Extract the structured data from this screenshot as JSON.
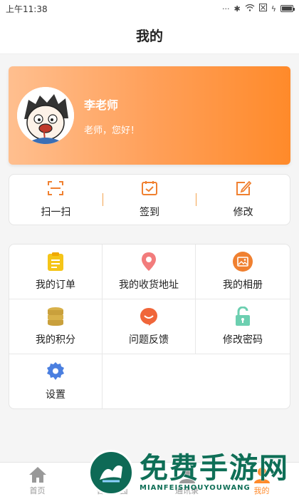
{
  "status_bar": {
    "time": "上午11:38"
  },
  "header": {
    "title": "我的"
  },
  "profile": {
    "name": "李老师",
    "greeting": "老师，您好！"
  },
  "actions": [
    {
      "label": "扫一扫",
      "icon": "scan-icon"
    },
    {
      "label": "签到",
      "icon": "calendar-check-icon"
    },
    {
      "label": "修改",
      "icon": "edit-icon"
    }
  ],
  "menu": [
    {
      "label": "我的订单",
      "icon": "clipboard-icon",
      "color": "#f5c518"
    },
    {
      "label": "我的收货地址",
      "icon": "location-pin-icon",
      "color": "#f27c7c"
    },
    {
      "label": "我的相册",
      "icon": "photo-icon",
      "color": "#f08030"
    },
    {
      "label": "我的积分",
      "icon": "coins-icon",
      "color": "#d8b14a"
    },
    {
      "label": "问题反馈",
      "icon": "feedback-icon",
      "color": "#f0663a"
    },
    {
      "label": "修改密码",
      "icon": "unlock-icon",
      "color": "#6ccfb0"
    },
    {
      "label": "设置",
      "icon": "gear-icon",
      "color": "#4a7fe0"
    }
  ],
  "bottom_nav": [
    {
      "label": "首页",
      "icon": "home-icon"
    },
    {
      "label": "智慧校园",
      "icon": "campus-icon"
    },
    {
      "label": "通讯录",
      "icon": "contacts-icon"
    },
    {
      "label": "我的",
      "icon": "user-icon"
    }
  ],
  "watermark": {
    "main": "免费手游网",
    "sub": "MIANFEISHOUYOUWANG"
  },
  "colors": {
    "accent": "#ff8a2a",
    "card_gradient_start": "#ffbf8f",
    "card_gradient_end": "#ff8a2a"
  }
}
